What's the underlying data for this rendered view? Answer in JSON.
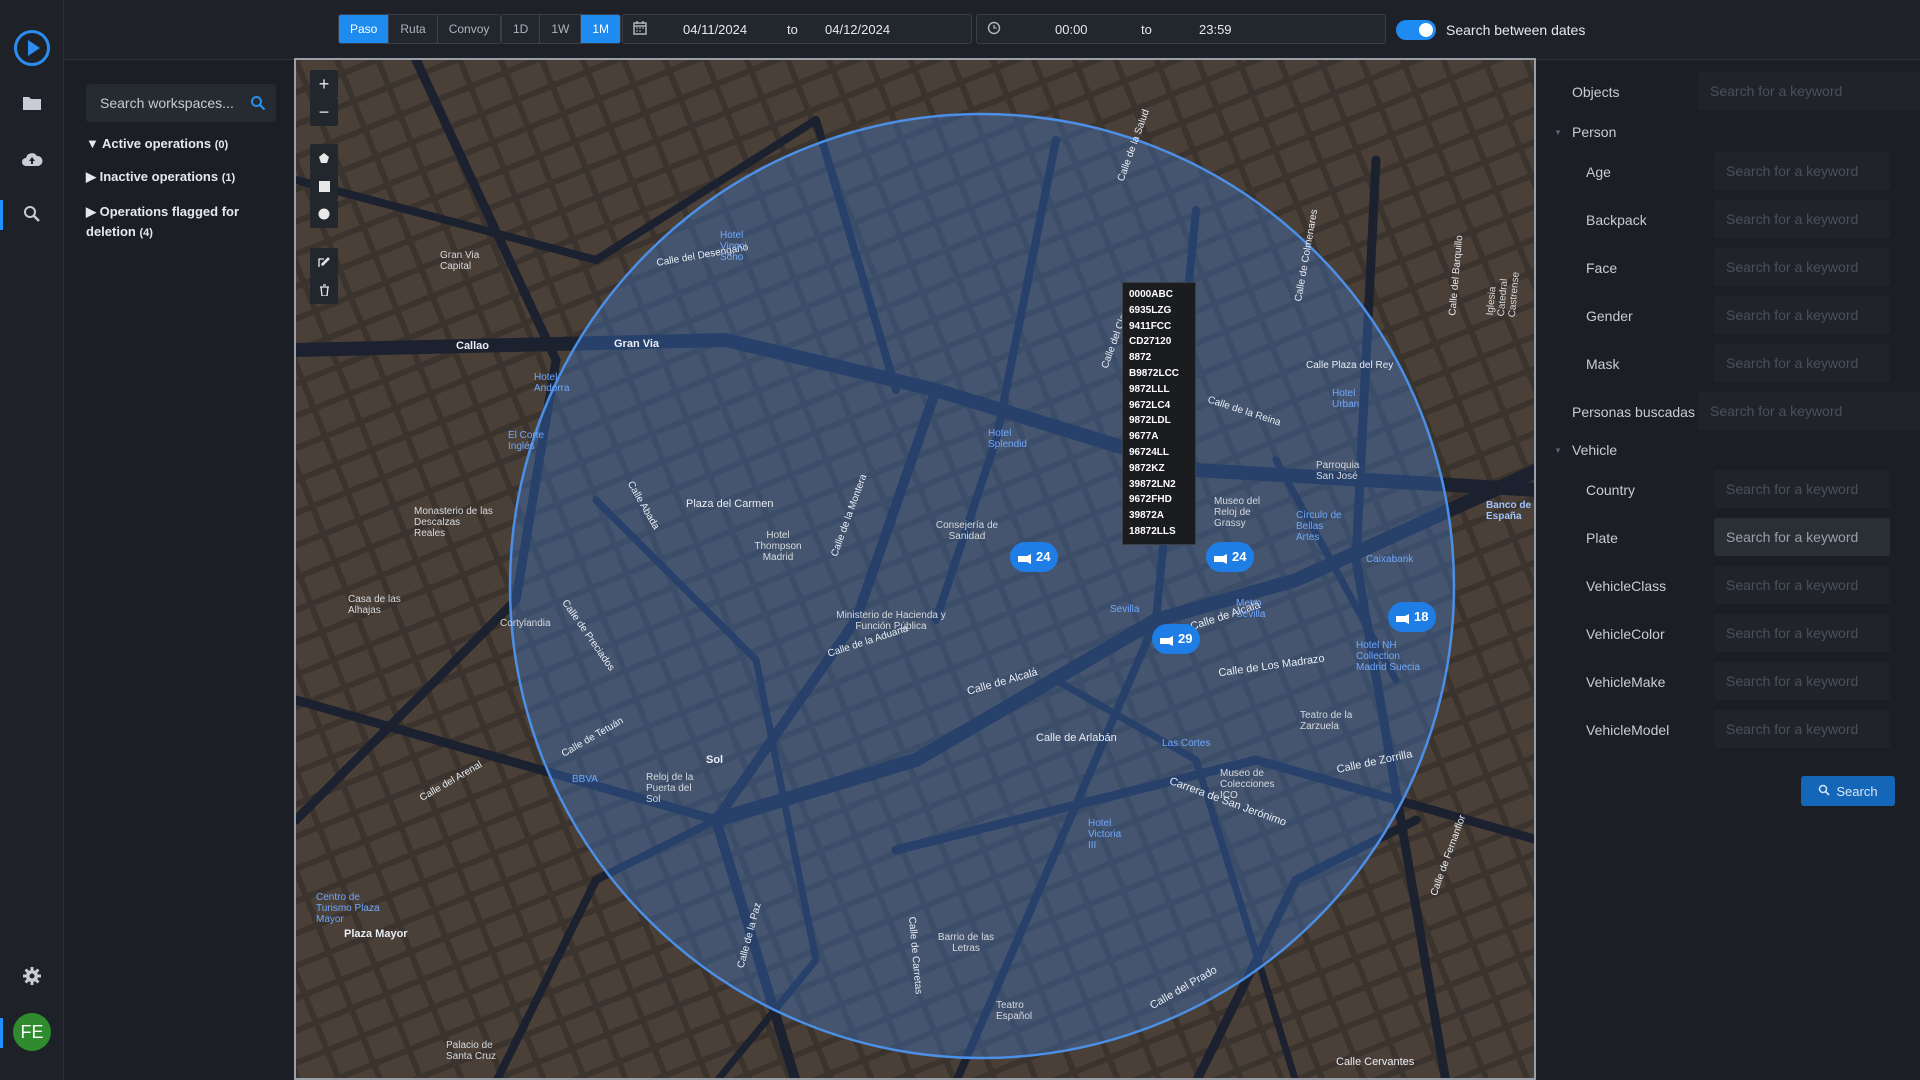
{
  "rail": {
    "logo": "play-logo",
    "items": [
      "folder-icon",
      "cloud-upload-icon",
      "search-icon"
    ],
    "settings": "gear-icon",
    "avatar": "FE"
  },
  "topbar": {
    "modes": [
      "Paso",
      "Ruta",
      "Convoy"
    ],
    "ranges": [
      "1D",
      "1W",
      "1M"
    ],
    "date_from": "04/11/2024",
    "date_to": "04/12/2024",
    "to_label": "to",
    "time_from": "00:00",
    "time_to": "23:59",
    "toggle_label": "Search between dates"
  },
  "workspaces": {
    "search_placeholder": "Search workspaces...",
    "active": {
      "label": "Active operations",
      "count": "(0)"
    },
    "inactive": {
      "label": "Inactive operations",
      "count": "(1)"
    },
    "flagged": {
      "label": "Operations flagged for deletion",
      "count": "(4)"
    }
  },
  "map": {
    "zoom_in": "+",
    "zoom_out": "−",
    "clusters": [
      "24",
      "24",
      "29",
      "18"
    ],
    "plates": [
      "0000ABC",
      "6935LZG",
      "9411FCC",
      "CD27120",
      "8872",
      "B9872LCC",
      "9872LLL",
      "9672LC4",
      "9872LDL",
      "9677A",
      "96724LL",
      "9872KZ",
      "39872LN2",
      "9672FHD",
      "39872A",
      "18872LLS"
    ],
    "labels": [
      "Gran Via",
      "Callao",
      "Plaza del Carmen",
      "Sol",
      "Calle de Alcalá",
      "Calle de Alcalá",
      "Calle de Arlabán",
      "Carrera de San Jerónimo",
      "Calle de Los Madrazo",
      "Calle de Zorrilla",
      "Calle del Prado",
      "Calle Cervantes",
      "Plaza Mayor",
      "Calle de la Montera",
      "Calle de Preciados",
      "Calle del Desengaño",
      "Calle de Tetuán",
      "Calle del Arenal",
      "Calle de la Aduana",
      "Calle Plaza del Rey",
      "Banco de España",
      "Ministerio de Hacienda y Función Pública",
      "Consejería de Sanidad",
      "Hotel Thompson Madrid",
      "Barrio de las Letras",
      "Sevilla",
      "Las Cortes",
      "Metro Sevilla",
      "Caixabank",
      "Hotel NH Collection Madrid Suecia",
      "Museo de Colecciones ICO",
      "Teatro de la Zarzuela",
      "El Corte Inglés",
      "Monasterio de las Descalzas Reales",
      "Casa de las Alhajas",
      "Cortylandia",
      "Reloj de la Puerta del Sol",
      "BBVA",
      "Centro de Turismo Plaza Mayor",
      "Calle del Clavel",
      "Calle de la Reina",
      "Calle de Colmenares",
      "Calle del Barquillo",
      "Hotel Splendid",
      "Parroquia San José",
      "Hotel Urban",
      "Palacio de Santa Cruz",
      "Teatro Español",
      "Calle de Carretas",
      "Calle de la Paz",
      "Calle Abada",
      "Calle de la Salud",
      "Gran Via Capital",
      "Iglesia Catedral Castrense",
      "Calle de Fernanflor",
      "Museo del Reloj de Grassy",
      "Círculo de Bellas Artes",
      "Hotel Andorra",
      "Hotel Vincci Soho",
      "Hotel Victoria III"
    ]
  },
  "filters": {
    "objects": {
      "label": "Objects",
      "placeholder": "Search for a keyword"
    },
    "person": {
      "label": "Person",
      "fields": [
        {
          "label": "Age",
          "placeholder": "Search for a keyword"
        },
        {
          "label": "Backpack",
          "placeholder": "Search for a keyword"
        },
        {
          "label": "Face",
          "placeholder": "Search for a keyword"
        },
        {
          "label": "Gender",
          "placeholder": "Search for a keyword"
        },
        {
          "label": "Mask",
          "placeholder": "Search for a keyword"
        }
      ]
    },
    "buscadas": {
      "label": "Personas buscadas",
      "placeholder": "Search for a keyword"
    },
    "vehicle": {
      "label": "Vehicle",
      "fields": [
        {
          "label": "Country",
          "placeholder": "Search for a keyword"
        },
        {
          "label": "Plate",
          "placeholder": "Search for a keyword"
        },
        {
          "label": "VehicleClass",
          "placeholder": "Search for a keyword"
        },
        {
          "label": "VehicleColor",
          "placeholder": "Search for a keyword"
        },
        {
          "label": "VehicleMake",
          "placeholder": "Search for a keyword"
        },
        {
          "label": "VehicleModel",
          "placeholder": "Search for a keyword"
        }
      ]
    },
    "search_button": "Search"
  },
  "colors": {
    "accent": "#1e8bf0",
    "cluster": "#1e7ee6",
    "circle": "#3b7fd8"
  }
}
